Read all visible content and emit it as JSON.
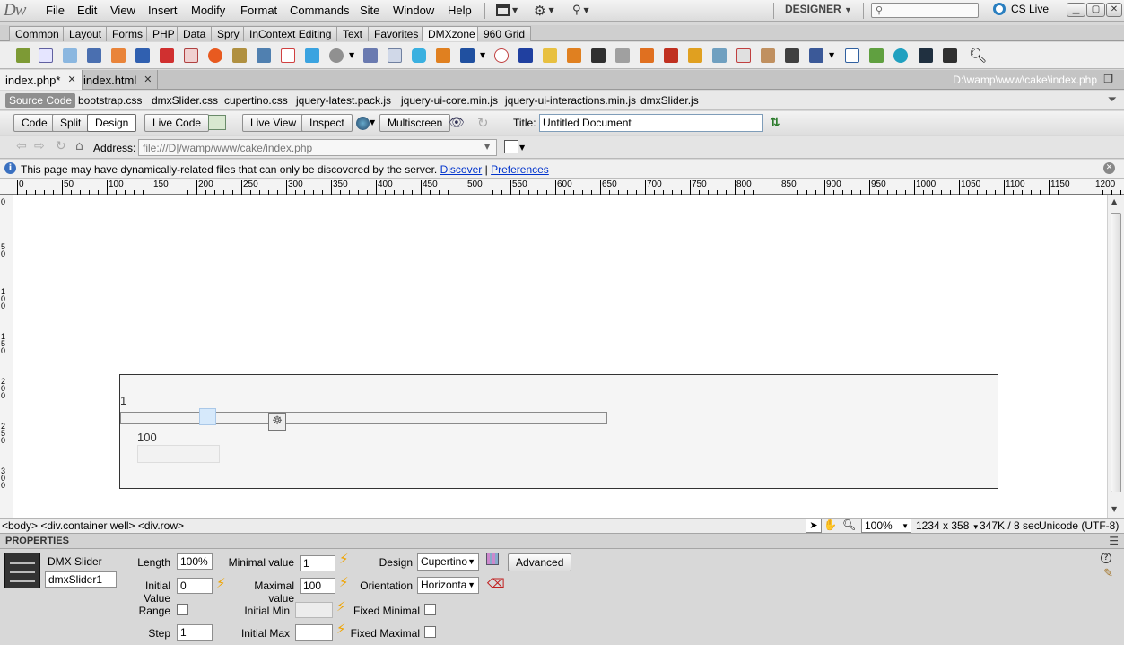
{
  "menubar": {
    "logo": "Dw",
    "items": [
      "File",
      "Edit",
      "View",
      "Insert",
      "Modify",
      "Format",
      "Commands",
      "Site",
      "Window",
      "Help"
    ],
    "workspace": "DESIGNER",
    "cslive": "CS Live"
  },
  "insert_tabs": [
    "Common",
    "Layout",
    "Forms",
    "PHP",
    "Data",
    "Spry",
    "InContext Editing",
    "Text",
    "Favorites",
    "DMXzone",
    "960 Grid"
  ],
  "insert_active": "DMXzone",
  "doc_tabs": [
    {
      "label": "index.php*"
    },
    {
      "label": "index.html"
    }
  ],
  "doc_path": "D:\\wamp\\www\\cake\\index.php",
  "related_files": [
    "Source Code",
    "bootstrap.css",
    "dmxSlider.css",
    "cupertino.css",
    "jquery-latest.pack.js",
    "jquery-ui-core.min.js",
    "jquery-ui-interactions.min.js",
    "dmxSlider.js"
  ],
  "doc_toolbar": {
    "code": "Code",
    "split": "Split",
    "design": "Design",
    "live_code": "Live Code",
    "live_view": "Live View",
    "inspect": "Inspect",
    "multiscreen": "Multiscreen",
    "title_label": "Title:",
    "title_value": "Untitled Document"
  },
  "browser_nav": {
    "address_label": "Address:",
    "address_value": "file:///D|/wamp/www/cake/index.php"
  },
  "infobar": {
    "message": "This page may have dynamically-related files that can only be discovered by the server.",
    "discover": "Discover",
    "sep": "|",
    "preferences": "Preferences"
  },
  "ruler_labels": [
    "0",
    "50",
    "100",
    "150",
    "200",
    "250",
    "300",
    "350",
    "400",
    "450",
    "500",
    "550",
    "600",
    "650",
    "700",
    "750",
    "800",
    "850",
    "900",
    "950",
    "1000",
    "1050",
    "1100",
    "1150",
    "1200"
  ],
  "vruler_labels": [
    "0",
    "50",
    "100",
    "150",
    "200",
    "250",
    "300"
  ],
  "canvas": {
    "min_value_text": "1",
    "max_value_text": "100"
  },
  "statusbar": {
    "tag_path": "<body> <div.container well> <div.row>",
    "zoom": "100%",
    "dimensions": "1234 x 358",
    "size": "347K / 8 sec",
    "encoding": "Unicode (UTF-8)"
  },
  "properties": {
    "header": "PROPERTIES",
    "widget_name": "DMX Slider",
    "widget_id": "dmxSlider1",
    "length_label": "Length",
    "length_value": "100%",
    "initial_value_label": "Initial Value",
    "initial_value": "0",
    "min_label": "Minimal value",
    "min_value": "1",
    "max_label": "Maximal value",
    "max_value": "100",
    "design_label": "Design",
    "design_value": "Cupertino",
    "orientation_label": "Orientation",
    "orientation_value": "Horizonta",
    "advanced": "Advanced",
    "range_label": "Range",
    "initial_min_label": "Initial Min",
    "fixed_min_label": "Fixed Minimal",
    "step_label": "Step",
    "step_value": "1",
    "initial_max_label": "Initial Max",
    "fixed_max_label": "Fixed Maximal"
  },
  "colors": {
    "accent": "#2a7fc0",
    "link": "#0033cc",
    "bolt": "#f0a400"
  }
}
